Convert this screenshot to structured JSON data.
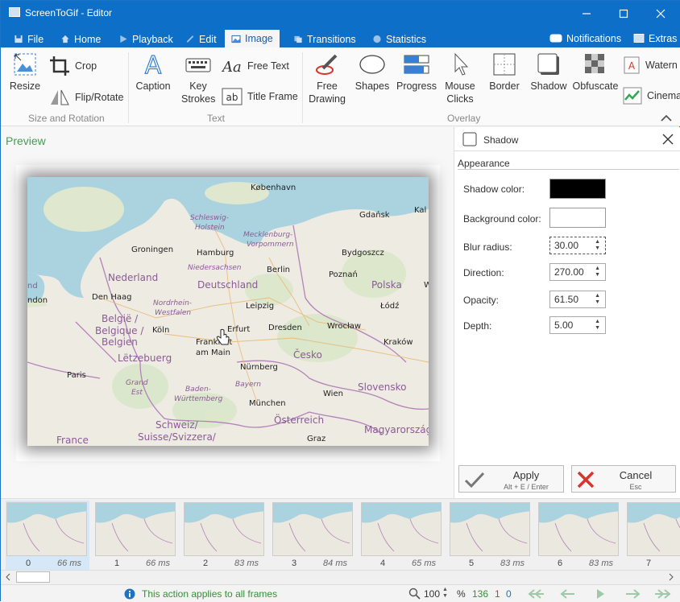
{
  "window": {
    "title": "ScreenToGif - Editor"
  },
  "menu": {
    "tabs": [
      "File",
      "Home",
      "Playback",
      "Edit",
      "Image",
      "Transitions",
      "Statistics"
    ],
    "active": "Image",
    "notifications": "Notifications",
    "extras": "Extras"
  },
  "ribbon": {
    "resize": "Resize",
    "crop": "Crop",
    "flip_rotate": "Flip/Rotate",
    "group_size": "Size and Rotation",
    "caption": "Caption",
    "key_strokes_1": "Key",
    "key_strokes_2": "Strokes",
    "free_text": "Free Text",
    "title_frame": "Title Frame",
    "group_text": "Text",
    "free_drawing_1": "Free",
    "free_drawing_2": "Drawing",
    "shapes": "Shapes",
    "progress": "Progress",
    "mouse_clicks_1": "Mouse",
    "mouse_clicks_2": "Clicks",
    "border": "Border",
    "shadow": "Shadow",
    "obfuscate": "Obfuscate",
    "watermark": "Watern",
    "cinemagraph": "Cinema",
    "group_overlay": "Overlay"
  },
  "preview": {
    "label": "Preview"
  },
  "map": {
    "labels": [
      "København",
      "Gdańsk",
      "Kal",
      "Schleswig-",
      "Holstein",
      "Mecklenburg-",
      "Vorpommern",
      "Groningen",
      "Hamburg",
      "Bydgoszcz",
      "Niedersachsen",
      "Berlin",
      "Nederland",
      "Deutschland",
      "Poznań",
      "Polska",
      "W",
      "nd",
      "ndon",
      "Den Haag",
      "Nordrhein-",
      "Westfalen",
      "Leipzig",
      "Łódź",
      "België /",
      "Belgique /",
      "Belgien",
      "Köln",
      "Erfurt",
      "Dresden",
      "Wrocław",
      "Frankfurt",
      "am Main",
      "Kraków",
      "Lëtzebuerg",
      "Česko",
      "Paris",
      "Nürnberg",
      "Grand",
      "Est",
      "Bayern",
      "Baden-",
      "Württemberg",
      "Slovensko",
      "Wien",
      "München",
      "Schweiz/",
      "Suisse/Svizzera/",
      "Österreich",
      "Magyarország",
      "France",
      "Graz"
    ]
  },
  "panel": {
    "title": "Shadow",
    "section": "Appearance",
    "shadow_color_label": "Shadow color:",
    "shadow_color": "#000000",
    "background_color_label": "Background color:",
    "background_color": "#ffffff",
    "blur_label": "Blur radius:",
    "blur_value": "30.00",
    "direction_label": "Direction:",
    "direction_value": "270.00",
    "opacity_label": "Opacity:",
    "opacity_value": "61.50",
    "depth_label": "Depth:",
    "depth_value": "5.00",
    "apply_label": "Apply",
    "apply_hint": "Alt + E / Enter",
    "cancel_label": "Cancel",
    "cancel_hint": "Esc"
  },
  "frames": [
    {
      "num": "0",
      "ms": "66 ms"
    },
    {
      "num": "1",
      "ms": "66 ms"
    },
    {
      "num": "2",
      "ms": "83 ms"
    },
    {
      "num": "3",
      "ms": "84 ms"
    },
    {
      "num": "4",
      "ms": "65 ms"
    },
    {
      "num": "5",
      "ms": "83 ms"
    },
    {
      "num": "6",
      "ms": "83 ms"
    },
    {
      "num": "7",
      "ms": ""
    }
  ],
  "status": {
    "message": "This action applies to all frames",
    "zoom": "100",
    "zoom_unit": "%",
    "frame_count": "136",
    "selected": "1",
    "current": "0"
  }
}
